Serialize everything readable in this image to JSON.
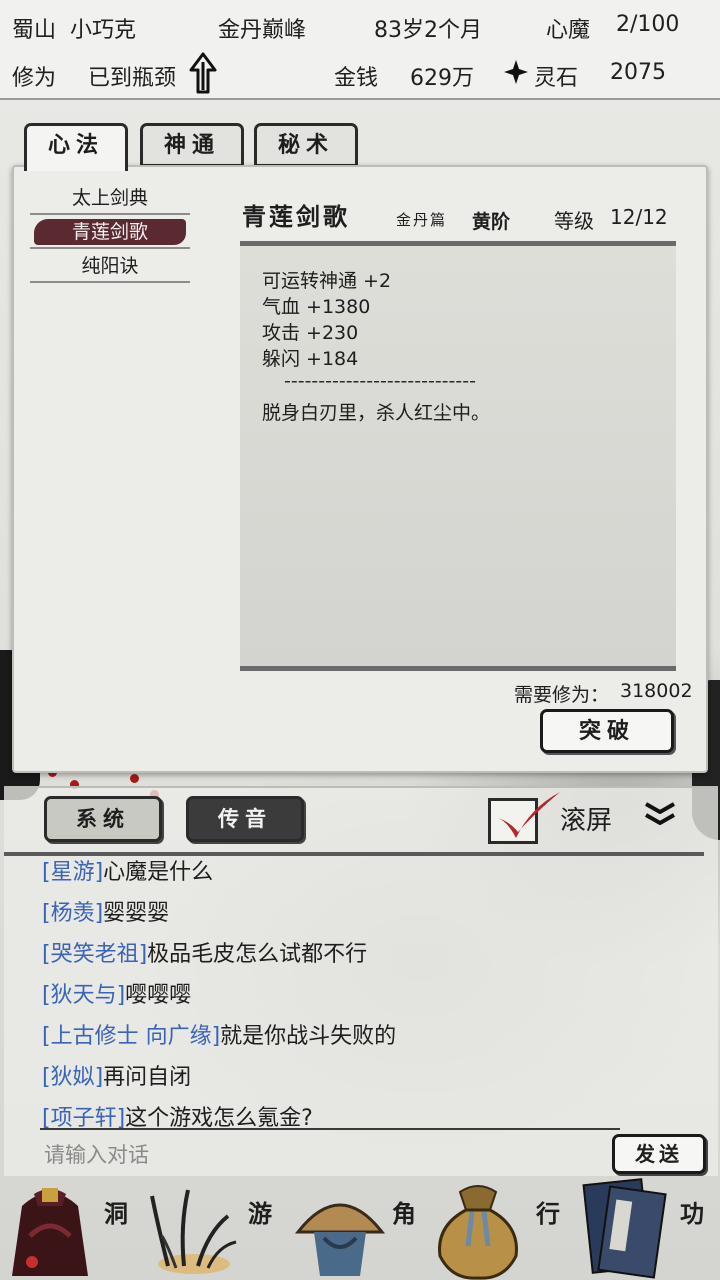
{
  "header": {
    "location": "蜀山",
    "player_name": "小巧克",
    "realm": "金丹巅峰",
    "age": "83岁2个月",
    "demon_label": "心魔",
    "demon_value": "2/100",
    "cultivation_label": "修为",
    "cultivation_status": "已到瓶颈",
    "money_label": "金钱",
    "money_value": "629万",
    "spirit_label": "灵石",
    "spirit_value": "2075"
  },
  "tabs": [
    {
      "label": "心法",
      "active": true
    },
    {
      "label": "神通",
      "active": false
    },
    {
      "label": "秘术",
      "active": false
    }
  ],
  "skill_list": [
    {
      "label": "太上剑典",
      "selected": false
    },
    {
      "label": "青莲剑歌",
      "selected": true
    },
    {
      "label": "纯阳诀",
      "selected": false
    }
  ],
  "detail": {
    "title": "青莲剑歌",
    "subtitle": "金丹篇",
    "grade": "黄阶",
    "level_label": "等级",
    "level_value": "12/12",
    "effects": [
      "可运转神通 +2",
      "气血 +1380",
      "攻击 +230",
      "躲闪 +184"
    ],
    "separator": "----------------------------",
    "quote": "脱身白刃里，杀人红尘中。",
    "need_label": "需要修为：",
    "need_value": "318002",
    "breakthrough_label": "突破"
  },
  "chat": {
    "tabs": [
      "系统",
      "传音"
    ],
    "scroll_label": "滚屏",
    "auto_scroll": true,
    "messages": [
      {
        "name": "[星游]",
        "text": "心魔是什么"
      },
      {
        "name": "[杨羡]",
        "text": "婴婴婴"
      },
      {
        "name": "[哭笑老祖]",
        "text": "极品毛皮怎么试都不行"
      },
      {
        "name": "[狄天与]",
        "text": "嘤嘤嘤"
      },
      {
        "name": "[上古修士 向广缘]",
        "text": "就是你战斗失败的"
      },
      {
        "name": "[狄姒]",
        "text": "再问自闭"
      },
      {
        "name": "[项子轩]",
        "text": "这个游戏怎么氪金?"
      }
    ],
    "input_placeholder": "请输入对话",
    "send_label": "发送"
  },
  "nav": [
    {
      "label": "洞",
      "icon": "cave-bag-icon"
    },
    {
      "label": "游",
      "icon": "grass-icon"
    },
    {
      "label": "角",
      "icon": "straw-hat-icon"
    },
    {
      "label": "行",
      "icon": "pouch-icon"
    },
    {
      "label": "功",
      "icon": "books-icon"
    }
  ],
  "colors": {
    "accent_selected": "#5a2a30",
    "chat_name": "#3a64b8",
    "check_red": "#b3262d"
  }
}
